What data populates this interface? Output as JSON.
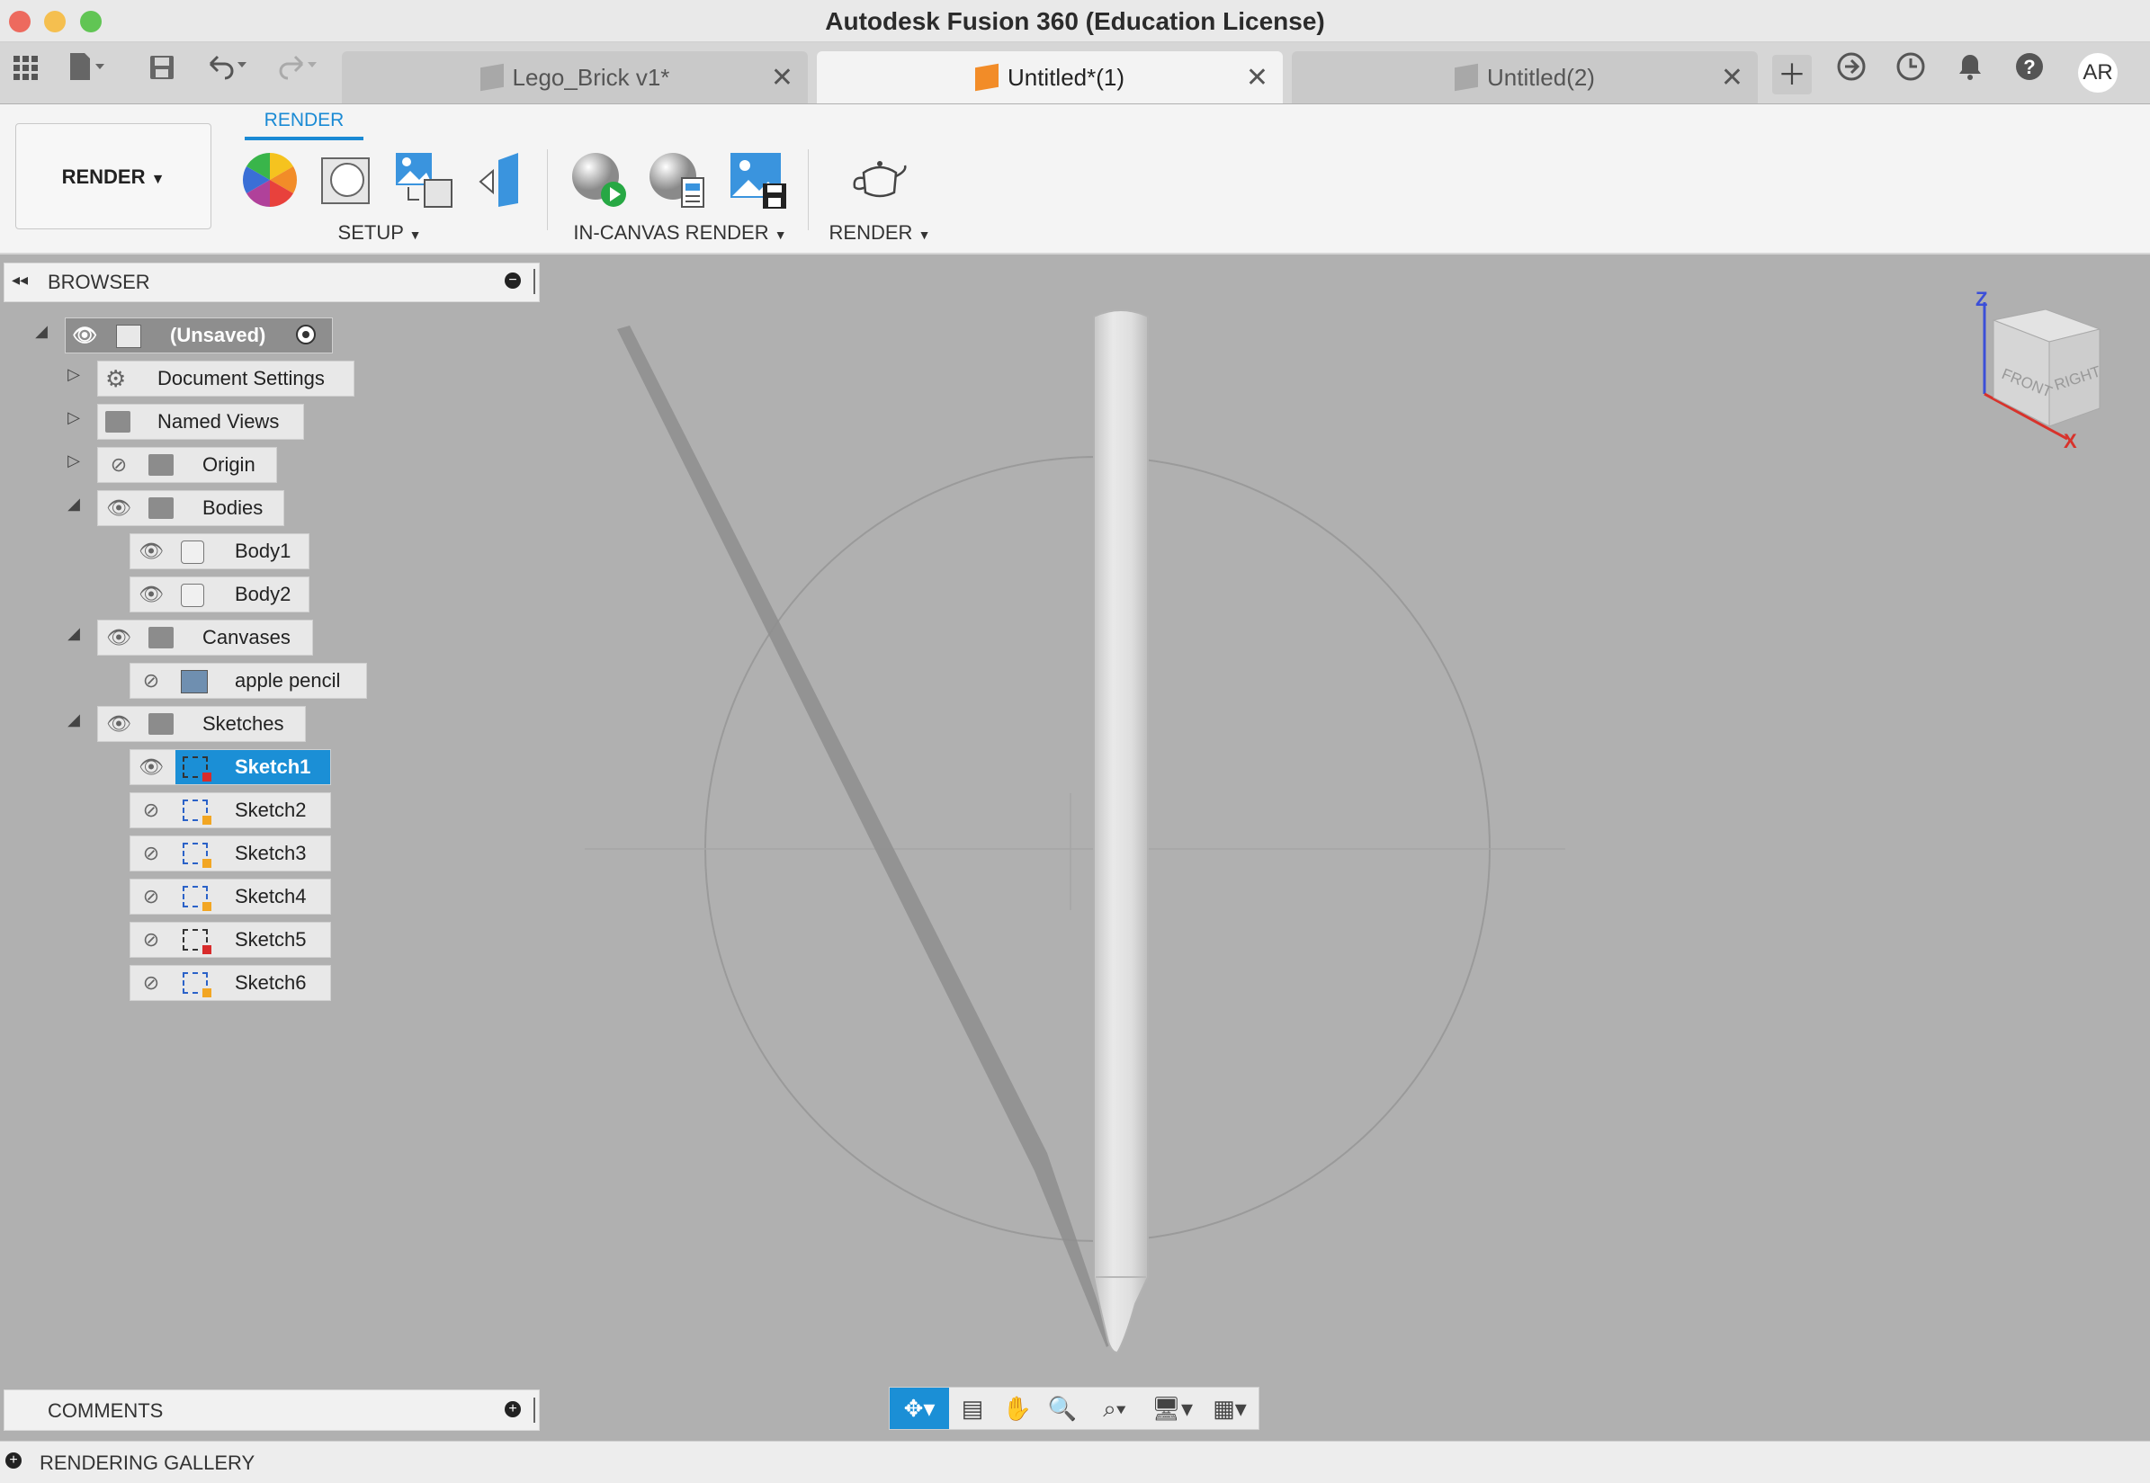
{
  "window": {
    "title": "Autodesk Fusion 360 (Education License)"
  },
  "tabs": [
    {
      "label": "Lego_Brick v1*",
      "active": false,
      "icon": "component-icon"
    },
    {
      "label": "Untitled*(1)",
      "active": true,
      "icon": "orange-component-icon"
    },
    {
      "label": "Untitled(2)",
      "active": false,
      "icon": "component-icon"
    }
  ],
  "user": {
    "initials": "AR"
  },
  "ribbon": {
    "workspace": "RENDER",
    "active_tab": "RENDER",
    "groups": {
      "setup": "SETUP",
      "in_canvas": "IN-CANVAS RENDER",
      "render": "RENDER"
    }
  },
  "browser": {
    "header": "BROWSER",
    "root": "(Unsaved)",
    "items": {
      "document_settings": "Document Settings",
      "named_views": "Named Views",
      "origin": "Origin",
      "bodies": "Bodies",
      "body1": "Body1",
      "body2": "Body2",
      "canvases": "Canvases",
      "apple_pencil": "apple pencil",
      "sketches": "Sketches",
      "sketch1": "Sketch1",
      "sketch2": "Sketch2",
      "sketch3": "Sketch3",
      "sketch4": "Sketch4",
      "sketch5": "Sketch5",
      "sketch6": "Sketch6"
    }
  },
  "viewcube": {
    "z": "Z",
    "x": "X",
    "front": "FRONT",
    "right": "RIGHT"
  },
  "comments": {
    "label": "COMMENTS"
  },
  "gallery": {
    "label": "RENDERING GALLERY"
  },
  "colors": {
    "accent": "#1b8fd6",
    "canvas": "#b0b0b0",
    "orange": "#f28c28"
  }
}
